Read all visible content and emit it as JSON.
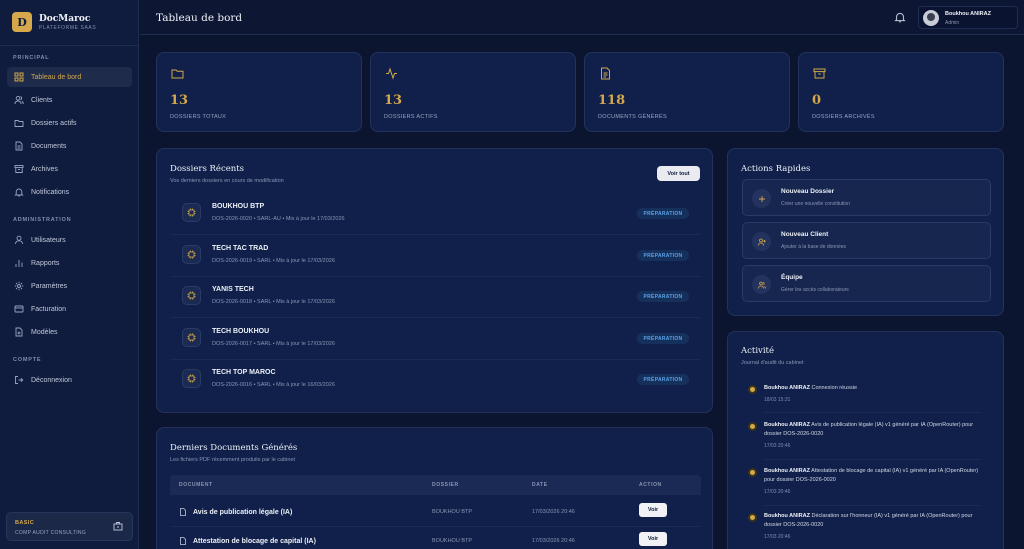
{
  "brand": {
    "name": "DocMaroc",
    "subtitle": "PLATEFORME SAAS",
    "logo_letter": "D"
  },
  "sidebar": {
    "sections": [
      {
        "label": "PRINCIPAL",
        "items": [
          {
            "label": "Tableau de bord",
            "icon": "grid-icon",
            "active": true
          },
          {
            "label": "Clients",
            "icon": "users-icon"
          },
          {
            "label": "Dossiers actifs",
            "icon": "folder-icon"
          },
          {
            "label": "Documents",
            "icon": "file-icon"
          },
          {
            "label": "Archives",
            "icon": "archive-icon"
          },
          {
            "label": "Notifications",
            "icon": "bell-icon"
          }
        ]
      },
      {
        "label": "ADMINISTRATION",
        "items": [
          {
            "label": "Utilisateurs",
            "icon": "user-icon"
          },
          {
            "label": "Rapports",
            "icon": "bar-chart-icon"
          },
          {
            "label": "Paramètres",
            "icon": "gear-icon"
          },
          {
            "label": "Facturation",
            "icon": "credit-card-icon"
          },
          {
            "label": "Modèles",
            "icon": "template-icon"
          }
        ]
      },
      {
        "label": "COMPTE",
        "items": [
          {
            "label": "Déconnexion",
            "icon": "logout-icon"
          }
        ]
      }
    ],
    "plan": {
      "name": "BASIC",
      "company": "COMP AUDIT CONSULTING"
    }
  },
  "header": {
    "title": "Tableau de bord",
    "user": {
      "name": "Boukhou ANIRAZ",
      "role": "Admin"
    }
  },
  "stats": [
    {
      "value": "13",
      "label": "DOSSIERS TOTAUX",
      "icon": "folder-icon"
    },
    {
      "value": "13",
      "label": "DOSSIERS ACTIFS",
      "icon": "activity-icon"
    },
    {
      "value": "118",
      "label": "DOCUMENTS GÉNÉRÉS",
      "icon": "file-text-icon"
    },
    {
      "value": "0",
      "label": "DOSSIERS ARCHIVÉS",
      "icon": "archive-icon"
    }
  ],
  "recent": {
    "title": "Dossiers Récents",
    "subtitle": "Vos derniers dossiers en cours de modification",
    "view_all": "Voir tout",
    "rows": [
      {
        "name": "BOUKHOU BTP",
        "meta": "DOS-2026-0020 • SARL-AU • Mis à jour le 17/03/2026",
        "status": "PRÉPARATION"
      },
      {
        "name": "TECH TAC TRAD",
        "meta": "DOS-2026-0019 • SARL • Mis à jour le 17/03/2026",
        "status": "PRÉPARATION"
      },
      {
        "name": "YANIS TECH",
        "meta": "DOS-2026-0018 • SARL • Mis à jour le 17/03/2026",
        "status": "PRÉPARATION"
      },
      {
        "name": "TECH BOUKHOU",
        "meta": "DOS-2026-0017 • SARL • Mis à jour le 17/03/2026",
        "status": "PRÉPARATION"
      },
      {
        "name": "TECH TOP MAROC",
        "meta": "DOS-2026-0016 • SARL • Mis à jour le 16/03/2026",
        "status": "PRÉPARATION"
      }
    ]
  },
  "quick_actions": {
    "title": "Actions Rapides",
    "items": [
      {
        "title": "Nouveau Dossier",
        "desc": "Créer une nouvelle constitution",
        "icon": "plus-icon"
      },
      {
        "title": "Nouveau Client",
        "desc": "Ajouter à la base de données",
        "icon": "user-plus-icon"
      },
      {
        "title": "Équipe",
        "desc": "Gérer les accès collaborateurs",
        "icon": "team-icon"
      }
    ]
  },
  "activity": {
    "title": "Activité",
    "subtitle": "Journal d'audit du cabinet",
    "items": [
      {
        "user": "Boukhou ANIRAZ",
        "text": "Connexion réussie",
        "time": "18/03 15:31"
      },
      {
        "user": "Boukhou ANIRAZ",
        "text": "Avis de publication légale (IA) v1 généré par IA (OpenRouter) pour dossier DOS-2026-0020",
        "time": "17/03 20:46"
      },
      {
        "user": "Boukhou ANIRAZ",
        "text": "Attestation de blocage de capital (IA) v1 généré par IA (OpenRouter) pour dossier DOS-2026-0020",
        "time": "17/03 20:46"
      },
      {
        "user": "Boukhou ANIRAZ",
        "text": "Déclaration sur l'honneur (IA) v1 généré par IA (OpenRouter) pour dossier DOS-2026-0020",
        "time": "17/03 20:46"
      }
    ]
  },
  "documents": {
    "title": "Derniers Documents Générés",
    "subtitle": "Les fichiers PDF récemment produits par le cabinet",
    "columns": [
      "DOCUMENT",
      "DOSSIER",
      "DATE",
      "ACTION"
    ],
    "rows": [
      {
        "document": "Avis de publication légale (IA)",
        "dossier": "BOUKHOU BTP",
        "date": "17/03/2026 20:46",
        "action": "Voir"
      },
      {
        "document": "Attestation de blocage de capital (IA)",
        "dossier": "BOUKHOU BTP",
        "date": "17/03/2026 20:46",
        "action": "Voir"
      }
    ]
  },
  "colors": {
    "accent": "#d4a84b",
    "background": "#0b1530",
    "card": "#10204a",
    "badge_text": "#5aa2e6"
  }
}
